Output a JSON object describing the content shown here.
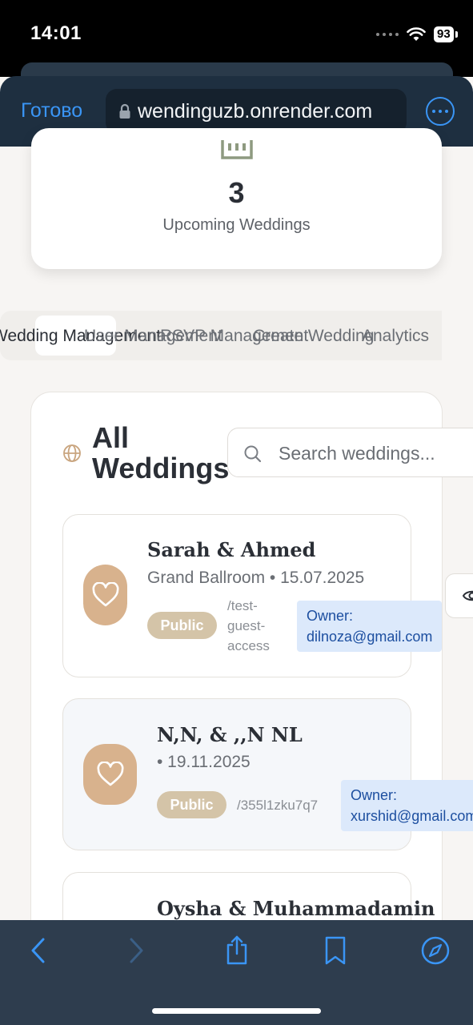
{
  "status_bar": {
    "time": "14:01",
    "battery": "93"
  },
  "browser": {
    "done_label": "Готово",
    "url": "wendinguzb.onrender.com"
  },
  "stats": {
    "number": "3",
    "label": "Upcoming Weddings"
  },
  "tabs": [
    {
      "label": "Wedding Management"
    },
    {
      "label": "User Management"
    },
    {
      "label": "RSVP Management"
    },
    {
      "label": "Create Wedding"
    },
    {
      "label": "Analytics"
    }
  ],
  "weddings_section": {
    "title": "All Weddings",
    "search_placeholder": "Search weddings..."
  },
  "weddings": [
    {
      "names": "Sarah & Ahmed",
      "details": "Grand Ballroom • 15.07.2025",
      "visibility": "Public",
      "link": "/test-guest-access",
      "owner_label": "Owner:",
      "owner_email": "dilnoza@gmail.com"
    },
    {
      "names": "N,N, & ,,N NL",
      "details": "• 19.11.2025",
      "visibility": "Public",
      "link": "/355l1zku7q7",
      "owner_label": "Owner:",
      "owner_email": "xurshid@gmail.com"
    },
    {
      "names": "Oysha & Muhammadamin"
    }
  ],
  "colors": {
    "accent": "#d8b28d",
    "badge": "#d4c4a8",
    "owner_bg": "#dce9fb",
    "browser_blue": "#3a95f5"
  }
}
